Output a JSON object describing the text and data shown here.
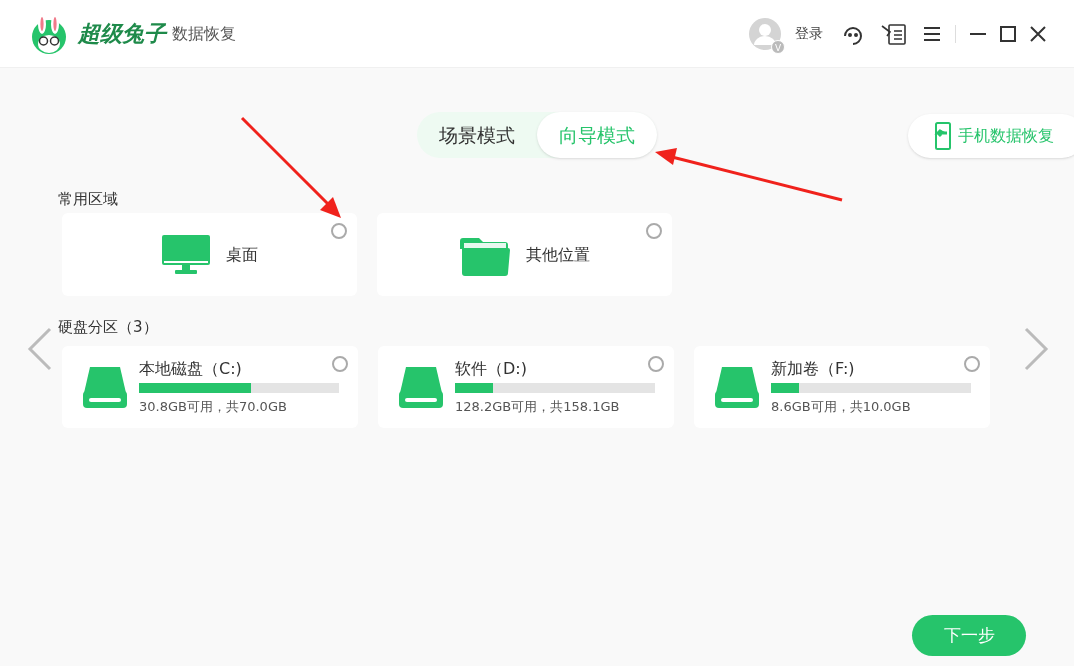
{
  "app": {
    "brand": "超级兔子",
    "product": "数据恢复"
  },
  "header": {
    "login": "登录",
    "avatar_badge": "V"
  },
  "tabs": [
    {
      "label": "场景模式",
      "selected": false
    },
    {
      "label": "向导模式",
      "selected": true
    }
  ],
  "mobile_button": "手机数据恢复",
  "common": {
    "title": "常用区域",
    "items": [
      {
        "kind": "monitor",
        "label": "桌面",
        "selected": false
      },
      {
        "kind": "folder",
        "label": "其他位置",
        "selected": false
      }
    ]
  },
  "drives": {
    "title": "硬盘分区（3）",
    "items": [
      {
        "name": "本地磁盘（C:)",
        "level": 0.56,
        "info": "30.8GB可用，共70.0GB",
        "selected": false
      },
      {
        "name": "软件（D:)",
        "level": 0.19,
        "info": "128.2GB可用，共158.1GB",
        "selected": false
      },
      {
        "name": "新加卷（F:)",
        "level": 0.14,
        "info": "8.6GB可用，共10.0GB",
        "selected": false
      }
    ]
  },
  "next_button": "下一步"
}
